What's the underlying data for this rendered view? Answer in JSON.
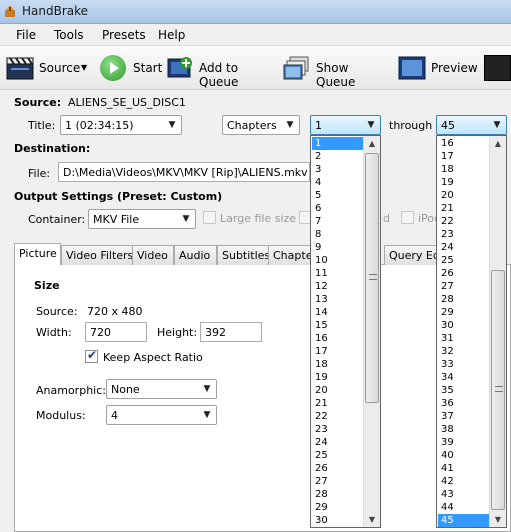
{
  "window": {
    "title": "HandBrake"
  },
  "menu": [
    "File",
    "Tools",
    "Presets",
    "Help"
  ],
  "toolbar": {
    "source": "Source",
    "start": "Start",
    "add_to_queue": "Add to Queue",
    "show_queue": "Show Queue",
    "preview": "Preview"
  },
  "source": {
    "label": "Source:",
    "value": "ALIENS_SE_US_DISC1"
  },
  "title_row": {
    "label": "Title:",
    "title_value": "1 (02:34:15)",
    "mode_value": "Chapters",
    "start_value": "1",
    "through_label": "through",
    "end_value": "45"
  },
  "destination": {
    "label": "Destination:",
    "file_label": "File:",
    "file_value": "D:\\Media\\Videos\\MKV\\MKV [Rip]\\ALIENS.mkv"
  },
  "output": {
    "heading": "Output Settings (Preset: Custom)",
    "container_label": "Container:",
    "container_value": "MKV File",
    "large_file": "Large file size",
    "partial_d": "d",
    "ipod": "iPod"
  },
  "tabs": [
    "Picture",
    "Video Filters",
    "Video",
    "Audio",
    "Subtitles",
    "Chapters",
    "Query Editor"
  ],
  "picture": {
    "size_heading": "Size",
    "source_label": "Source:",
    "source_value": "720 x 480",
    "width_label": "Width:",
    "width_value": "720",
    "height_label": "Height:",
    "height_value": "392",
    "keep_aspect": "Keep Aspect Ratio",
    "keep_aspect_checked": true,
    "anamorphic_label": "Anamorphic:",
    "anamorphic_value": "None",
    "modulus_label": "Modulus:",
    "modulus_value": "4"
  },
  "start_dropdown": {
    "items": [
      "1",
      "2",
      "3",
      "4",
      "5",
      "6",
      "7",
      "8",
      "9",
      "10",
      "11",
      "12",
      "13",
      "14",
      "15",
      "16",
      "17",
      "18",
      "19",
      "20",
      "21",
      "22",
      "23",
      "24",
      "25",
      "26",
      "27",
      "28",
      "29",
      "30"
    ],
    "selected": "1"
  },
  "end_dropdown": {
    "items": [
      "16",
      "17",
      "18",
      "19",
      "20",
      "21",
      "22",
      "23",
      "24",
      "25",
      "26",
      "27",
      "28",
      "29",
      "30",
      "31",
      "32",
      "33",
      "34",
      "35",
      "36",
      "37",
      "38",
      "39",
      "40",
      "41",
      "42",
      "43",
      "44",
      "45"
    ],
    "selected": "45"
  },
  "colors": {
    "selection": "#3399ff",
    "titlebar": "#b9d1ea"
  },
  "icons": {
    "app": "handbrake-icon",
    "source": "clapperboard-icon",
    "start": "play-icon",
    "add_to_queue": "add-queue-icon",
    "show_queue": "queue-icon",
    "preview": "preview-icon"
  }
}
